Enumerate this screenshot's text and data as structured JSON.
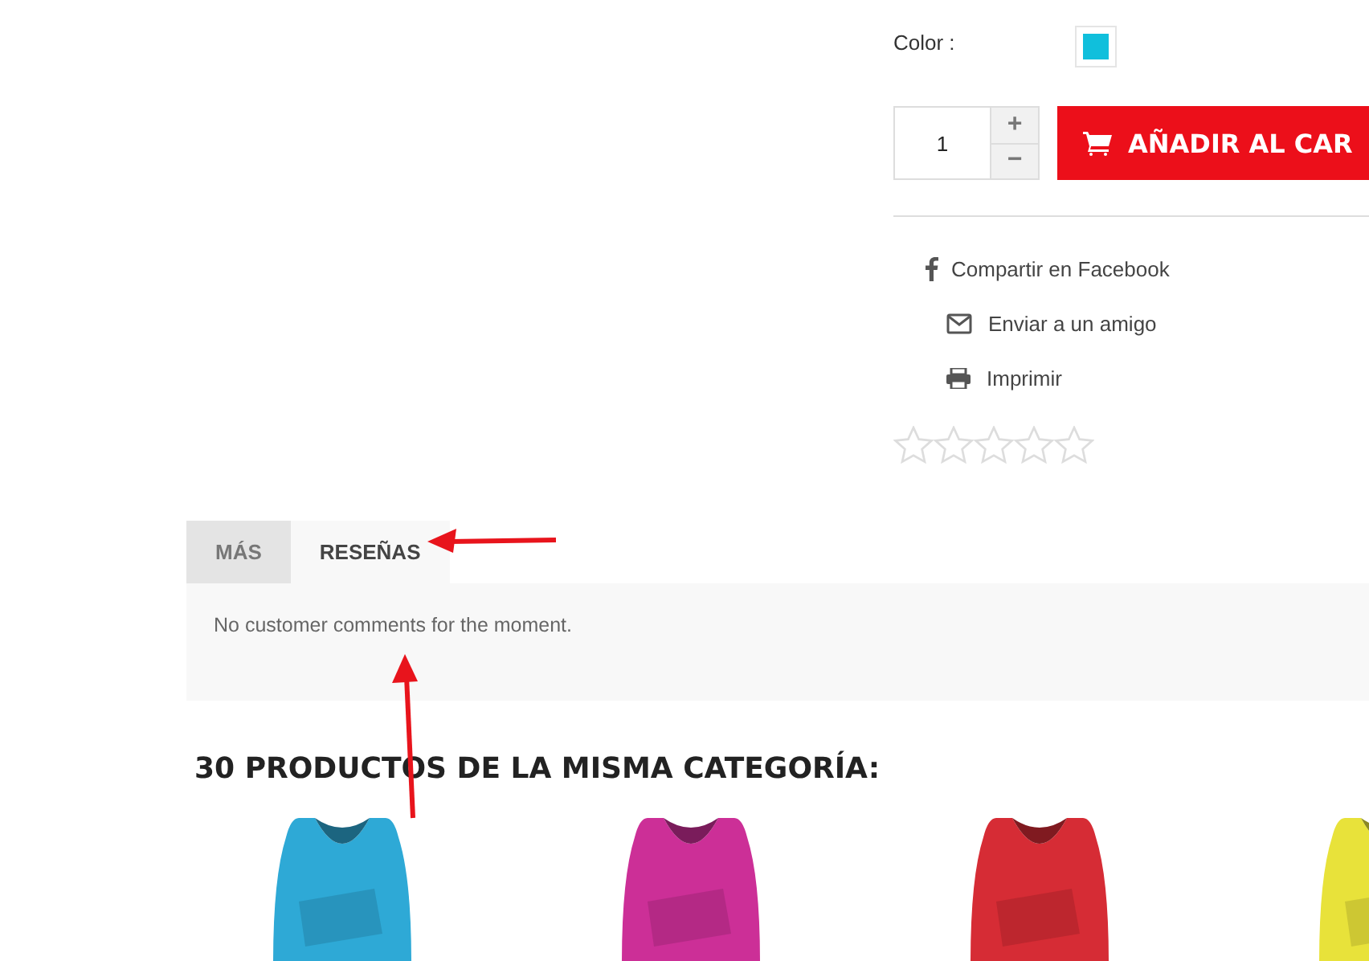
{
  "color_option": {
    "label": "Color :",
    "swatches": [
      {
        "color": "#10bfdc",
        "selected": true
      }
    ]
  },
  "quantity": {
    "value": "1",
    "increment": "+",
    "decrement": "−"
  },
  "add_to_cart": {
    "label": "AÑADIR AL CAR"
  },
  "share_links": [
    {
      "kind": "facebook",
      "label": "Compartir en Facebook"
    },
    {
      "kind": "email",
      "label": "Enviar a un amigo"
    },
    {
      "kind": "print",
      "label": "Imprimir"
    }
  ],
  "rating": {
    "stars": 0
  },
  "tabs": [
    {
      "label": "MÁS",
      "selected": false
    },
    {
      "label": "RESEÑAS",
      "selected": true
    }
  ],
  "reviews": {
    "message": "No customer comments for the moment."
  },
  "related": {
    "heading": "30 PRODUCTOS DE LA MISMA CATEGORÍA:"
  }
}
